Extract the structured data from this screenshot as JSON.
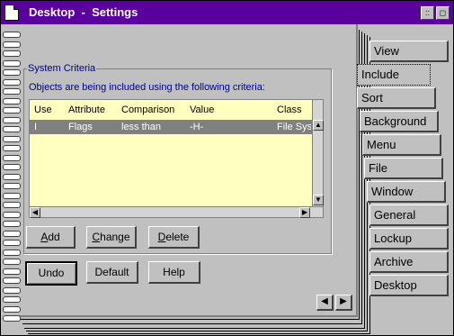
{
  "window": {
    "title": "Desktop  -  Settings",
    "minimize_glyph": "::",
    "maximize_glyph": "◻",
    "icon": "document-icon"
  },
  "group": {
    "label": "System Criteria",
    "info": "Objects are being included using the following criteria:"
  },
  "table": {
    "columns": [
      "Use",
      "Attribute",
      "Comparison",
      "Value",
      "Class"
    ],
    "rows": [
      {
        "use": "I",
        "attribute": "Flags",
        "comparison": "less than",
        "value": "-H-",
        "class": "File Syst"
      }
    ]
  },
  "buttons": {
    "add": "Add",
    "change": "Change",
    "delete": "Delete",
    "undo": "Undo",
    "default": "Default",
    "help": "Help"
  },
  "tabs": [
    "View",
    "Include",
    "Sort",
    "Background",
    "Menu",
    "File",
    "Window",
    "General",
    "Lockup",
    "Archive",
    "Desktop"
  ],
  "active_tab": "Include",
  "colors": {
    "titlebar": "#5a009c",
    "accent_text": "#000080",
    "table_bg": "#ffffc0"
  }
}
